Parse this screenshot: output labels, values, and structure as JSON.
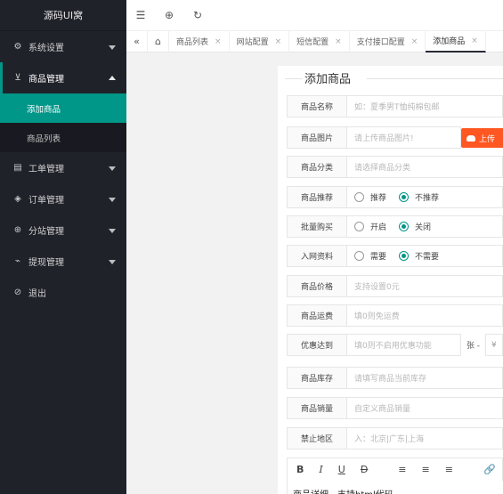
{
  "sidebar": {
    "logo": "源码UI窝",
    "items": [
      {
        "label": "系统设置",
        "icon": "gear-icon"
      },
      {
        "label": "商品管理",
        "icon": "cart-icon"
      },
      {
        "label": "工单管理",
        "icon": "ticket-icon"
      },
      {
        "label": "订单管理",
        "icon": "layers-icon"
      },
      {
        "label": "分站管理",
        "icon": "globe-icon"
      },
      {
        "label": "提现管理",
        "icon": "pulse-icon"
      },
      {
        "label": "退出",
        "icon": "shield-icon"
      }
    ],
    "sub_items": [
      {
        "label": "添加商品"
      },
      {
        "label": "商品列表"
      }
    ]
  },
  "tabs": [
    "商品列表",
    "网站配置",
    "短信配置",
    "支付接口配置",
    "添加商品"
  ],
  "form": {
    "title": "添加商品",
    "name": {
      "label": "商品名称",
      "placeholder": "如：夏季男T恤纯棉包邮"
    },
    "image": {
      "label": "商品图片",
      "placeholder": "请上传商品图片!",
      "button": "上传"
    },
    "category": {
      "label": "商品分类",
      "placeholder": "请选择商品分类"
    },
    "recommend": {
      "label": "商品推荐",
      "options": [
        "推荐",
        "不推荐"
      ],
      "selected": "不推荐"
    },
    "bulk": {
      "label": "批量购买",
      "options": [
        "开启",
        "关闭"
      ],
      "selected": "关闭"
    },
    "network": {
      "label": "入网资料",
      "options": [
        "需要",
        "不需要"
      ],
      "selected": "不需要"
    },
    "price": {
      "label": "商品价格",
      "placeholder": "支持设置0元"
    },
    "shipping": {
      "label": "商品运费",
      "placeholder": "填0则免运费"
    },
    "discount": {
      "label": "优惠达到",
      "placeholder": "填0则不启用优惠功能",
      "suffix": "张 -",
      "currency": "¥"
    },
    "stock": {
      "label": "商品库存",
      "placeholder": "请填写商品当前库存"
    },
    "sales": {
      "label": "商品销量",
      "placeholder": "自定义商品销量"
    },
    "region": {
      "label": "禁止地区",
      "placeholder": "入：北京|广东|上海"
    },
    "editor": {
      "text": "商品详细，支持html代码"
    }
  },
  "colors": {
    "accent": "#009688",
    "sidebar_bg": "#20222a",
    "upload": "#ff5722"
  }
}
